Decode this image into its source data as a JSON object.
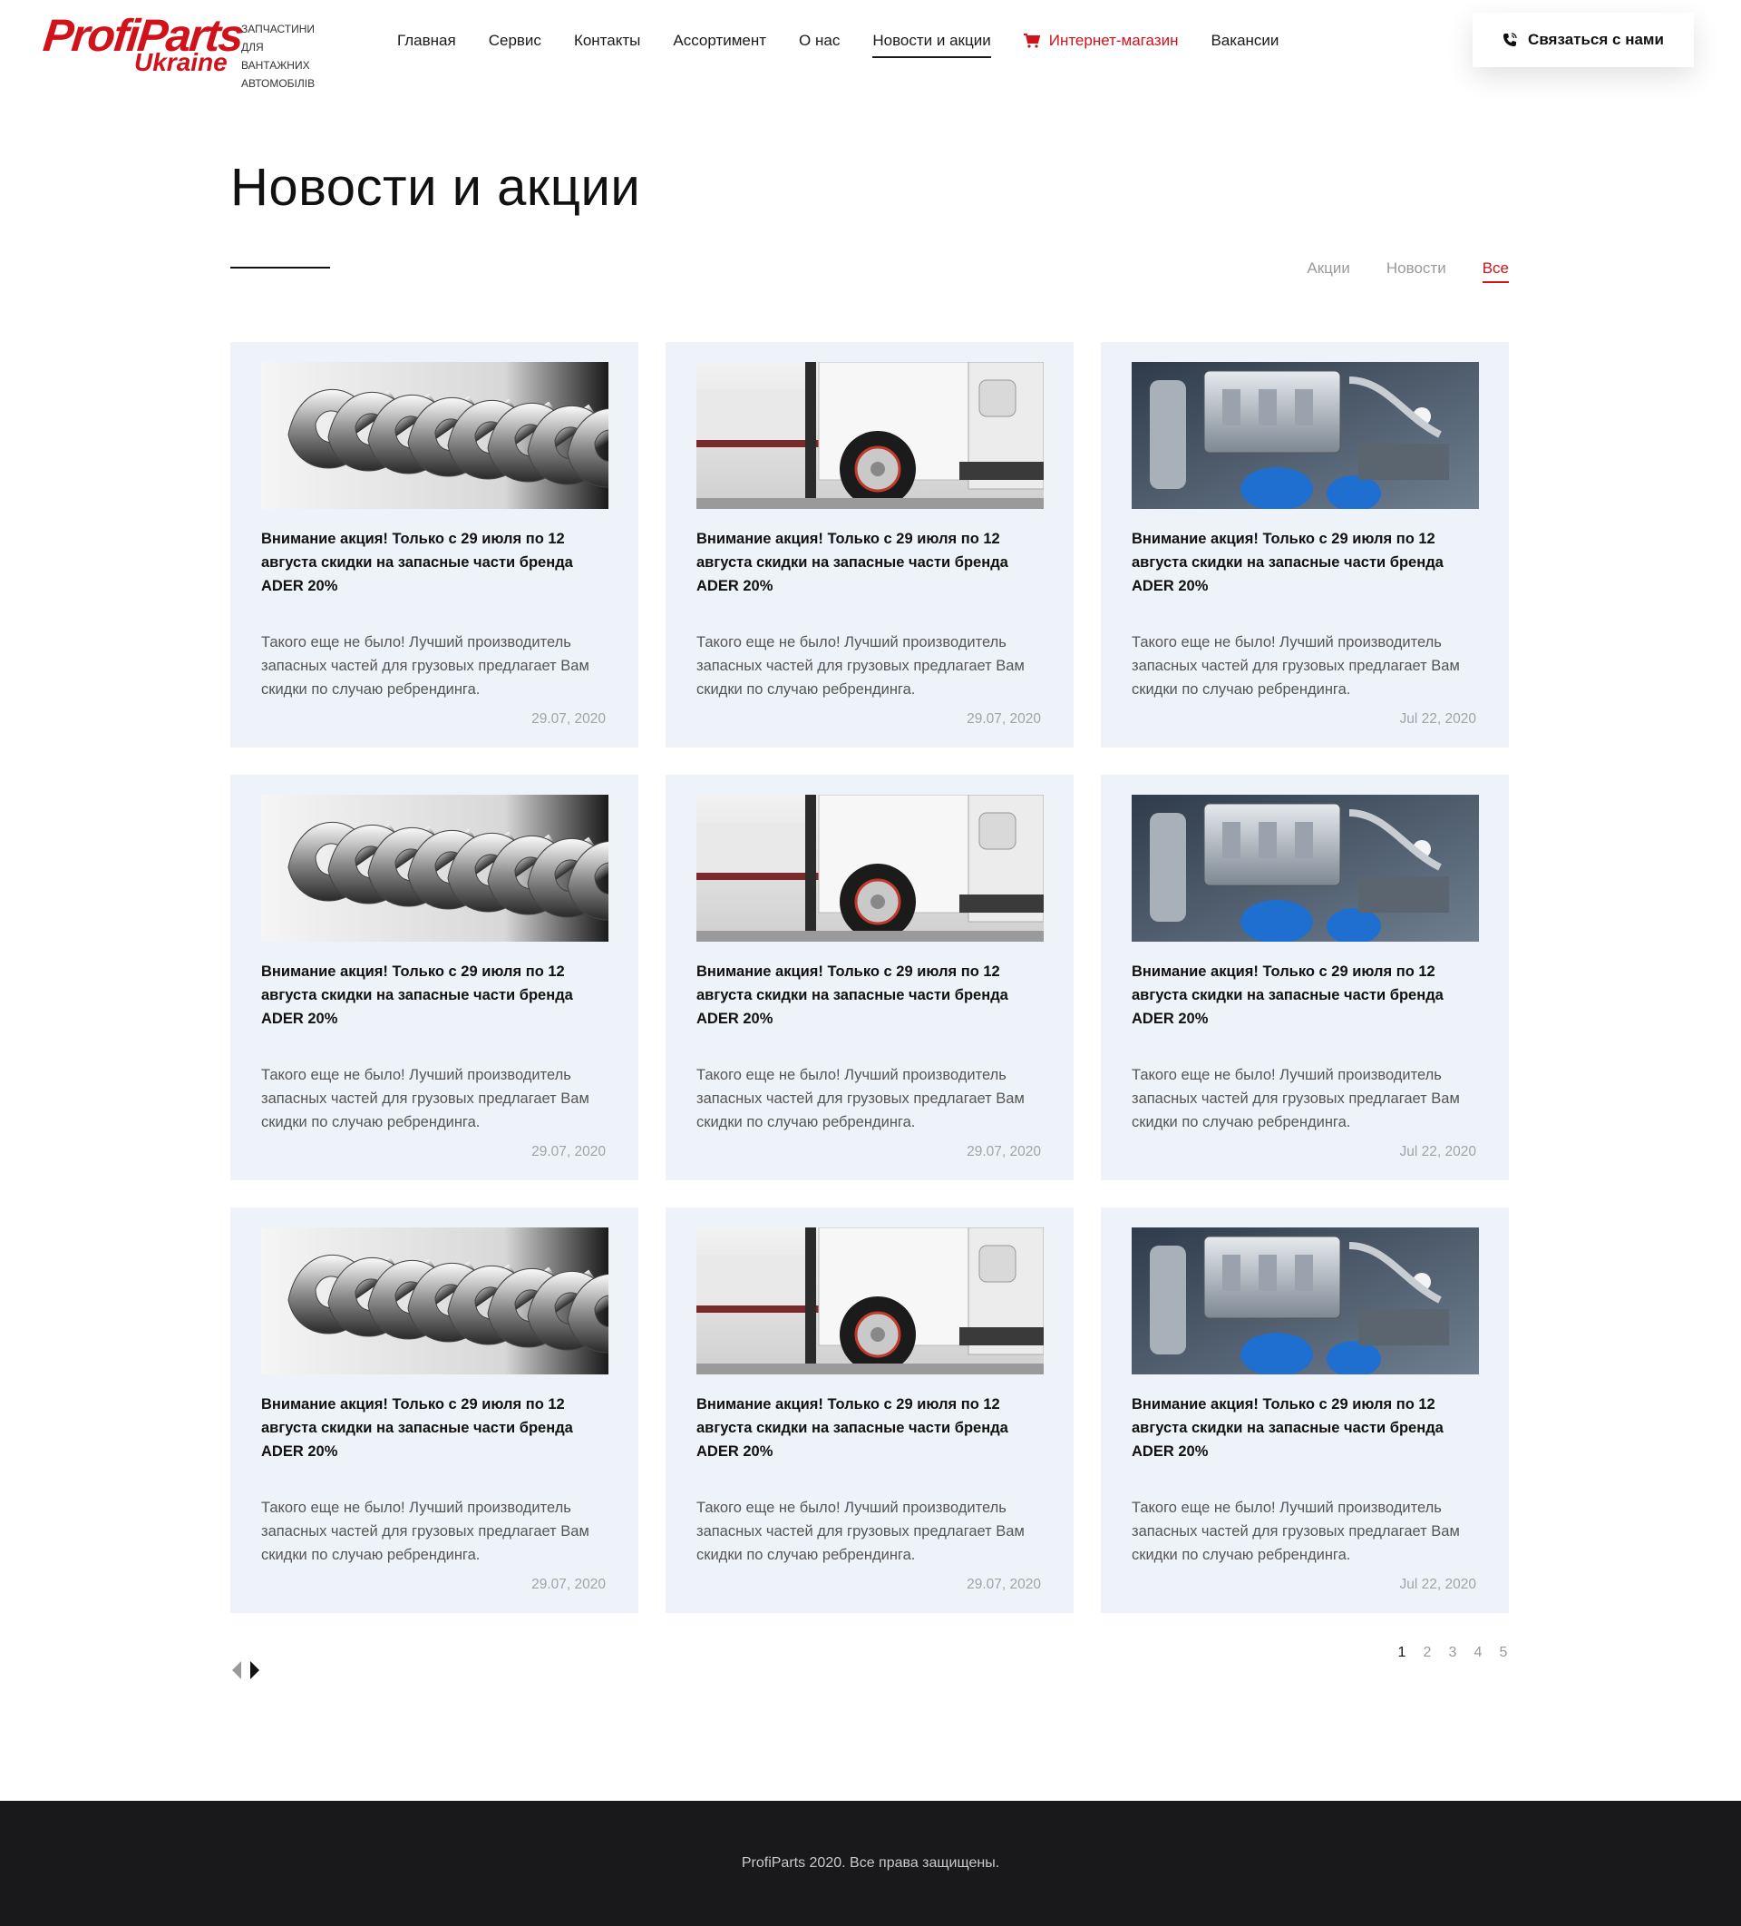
{
  "brand": {
    "logo_main": "ProfiParts",
    "logo_sub": "Ukraine",
    "tagline": "ЗАПЧАСТИНИ ДЛЯ ВАНТАЖНИХ АВТОМОБІЛІВ",
    "accent_color": "#d0121b"
  },
  "nav": {
    "items": [
      {
        "label": "Главная"
      },
      {
        "label": "Сервис"
      },
      {
        "label": "Контакты"
      },
      {
        "label": "Ассортимент"
      },
      {
        "label": "О нас"
      },
      {
        "label": "Новости и акции"
      },
      {
        "label": "Интернет-магазин"
      },
      {
        "label": "Вакансии"
      }
    ],
    "contact_button": "Связаться с нами"
  },
  "page": {
    "title": "Новости и акции",
    "filters": [
      {
        "label": "Акции"
      },
      {
        "label": "Новости"
      },
      {
        "label": "Все"
      }
    ]
  },
  "cards": [
    {
      "image": "wrenches",
      "title": "Внимание акция! Только с 29 июля по 12 августа скидки на запасные части бренда ADER 20%",
      "text": "Такого еще не было! Лучший производитель запасных частей для грузовых предлагает Вам скидки по случаю ребрендинга.",
      "date": "29.07, 2020"
    },
    {
      "image": "truck",
      "title": "Внимание акция! Только с 29 июля по 12 августа скидки на запасные части бренда ADER 20%",
      "text": "Такого еще не было! Лучший производитель запасных частей для грузовых предлагает Вам скидки по случаю ребрендинга.",
      "date": "29.07, 2020"
    },
    {
      "image": "engine",
      "title": "Внимание акция! Только с 29 июля по 12 августа скидки на запасные части бренда ADER 20%",
      "text": "Такого еще не было! Лучший производитель запасных частей для грузовых предлагает Вам скидки по случаю ребрендинга.",
      "date": "Jul 22, 2020"
    },
    {
      "image": "wrenches",
      "title": "Внимание акция! Только с 29 июля по 12 августа скидки на запасные части бренда ADER 20%",
      "text": "Такого еще не было! Лучший производитель запасных частей для грузовых предлагает Вам скидки по случаю ребрендинга.",
      "date": "29.07, 2020"
    },
    {
      "image": "truck",
      "title": "Внимание акция! Только с 29 июля по 12 августа скидки на запасные части бренда ADER 20%",
      "text": "Такого еще не было! Лучший производитель запасных частей для грузовых предлагает Вам скидки по случаю ребрендинга.",
      "date": "29.07, 2020"
    },
    {
      "image": "engine",
      "title": "Внимание акция! Только с 29 июля по 12 августа скидки на запасные части бренда ADER 20%",
      "text": "Такого еще не было! Лучший производитель запасных частей для грузовых предлагает Вам скидки по случаю ребрендинга.",
      "date": "Jul 22, 2020"
    },
    {
      "image": "wrenches",
      "title": "Внимание акция! Только с 29 июля по 12 августа скидки на запасные части бренда ADER 20%",
      "text": "Такого еще не было! Лучший производитель запасных частей для грузовых предлагает Вам скидки по случаю ребрендинга.",
      "date": "29.07, 2020"
    },
    {
      "image": "truck",
      "title": "Внимание акция! Только с 29 июля по 12 августа скидки на запасные части бренда ADER 20%",
      "text": "Такого еще не было! Лучший производитель запасных частей для грузовых предлагает Вам скидки по случаю ребрендинга.",
      "date": "29.07, 2020"
    },
    {
      "image": "engine",
      "title": "Внимание акция! Только с 29 июля по 12 августа скидки на запасные части бренда ADER 20%",
      "text": "Такого еще не было! Лучший производитель запасных частей для грузовых предлагает Вам скидки по случаю ребрендинга.",
      "date": "Jul 22, 2020"
    }
  ],
  "pagination": {
    "pages": [
      "1",
      "2",
      "3",
      "4",
      "5"
    ],
    "current": "1",
    "prev_icon": "arrow-left-icon",
    "next_icon": "arrow-right-icon"
  },
  "footer": {
    "text": "ProfiParts 2020. Все права защищены."
  }
}
